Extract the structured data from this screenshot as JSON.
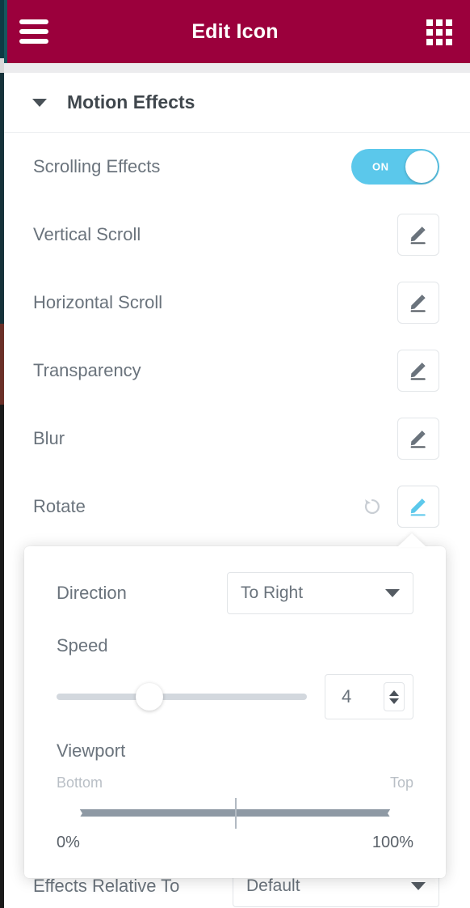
{
  "header": {
    "title": "Edit Icon",
    "menu_icon": "hamburger-icon",
    "grid_icon": "apps-grid-icon",
    "bg_color": "#9b003c"
  },
  "section": {
    "title": "Motion Effects",
    "collapse_icon": "chevron-down-icon"
  },
  "rows": [
    {
      "label": "Scrolling Effects",
      "control": "toggle",
      "toggle_state": "ON"
    },
    {
      "label": "Vertical Scroll",
      "control": "edit",
      "icon": "pencil-icon"
    },
    {
      "label": "Horizontal Scroll",
      "control": "edit",
      "icon": "pencil-icon"
    },
    {
      "label": "Transparency",
      "control": "edit",
      "icon": "pencil-icon"
    },
    {
      "label": "Blur",
      "control": "edit",
      "icon": "pencil-icon"
    },
    {
      "label": "Rotate",
      "control": "edit-active",
      "icon": "pencil-icon",
      "reset_icon": "reset-icon"
    }
  ],
  "popup": {
    "direction": {
      "label": "Direction",
      "value": "To Right",
      "caret_icon": "chevron-down-icon"
    },
    "speed": {
      "label": "Speed",
      "value": "4",
      "slider_percent": 37,
      "stepper_up_icon": "chevron-up-icon",
      "stepper_down_icon": "chevron-down-icon"
    },
    "viewport": {
      "label": "Viewport",
      "scale_start": "Bottom",
      "scale_end": "Top",
      "value_start": "0%",
      "value_end": "100%"
    }
  },
  "bottom": {
    "label": "Effects Relative To",
    "value": "Default",
    "caret_icon": "chevron-down-icon"
  },
  "colors": {
    "brand": "#9b003c",
    "accent": "#5bc8eb",
    "text": "#6a737c",
    "heading": "#40474d"
  }
}
